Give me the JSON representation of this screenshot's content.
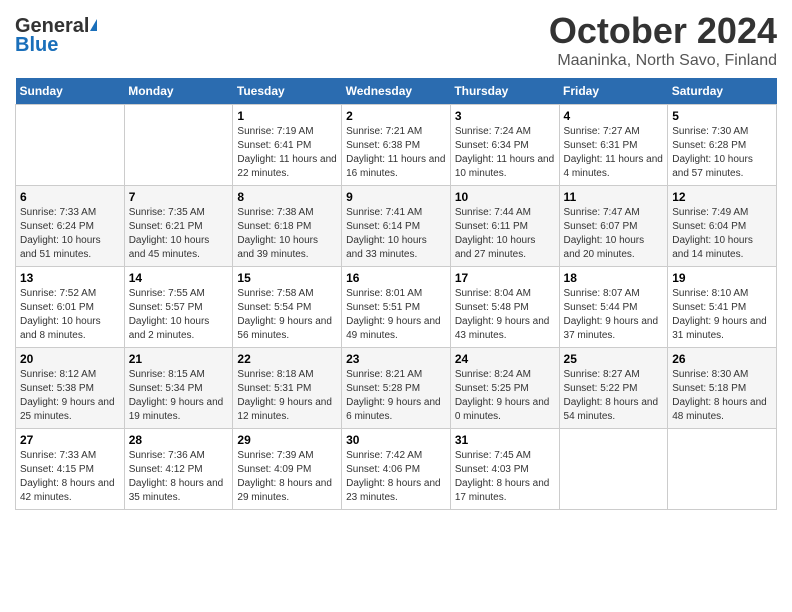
{
  "logo": {
    "general": "General",
    "blue": "Blue"
  },
  "title": {
    "month": "October 2024",
    "location": "Maaninka, North Savo, Finland"
  },
  "days_of_week": [
    "Sunday",
    "Monday",
    "Tuesday",
    "Wednesday",
    "Thursday",
    "Friday",
    "Saturday"
  ],
  "weeks": [
    [
      {
        "day": "",
        "sunrise": "",
        "sunset": "",
        "daylight": ""
      },
      {
        "day": "",
        "sunrise": "",
        "sunset": "",
        "daylight": ""
      },
      {
        "day": "1",
        "sunrise": "Sunrise: 7:19 AM",
        "sunset": "Sunset: 6:41 PM",
        "daylight": "Daylight: 11 hours and 22 minutes."
      },
      {
        "day": "2",
        "sunrise": "Sunrise: 7:21 AM",
        "sunset": "Sunset: 6:38 PM",
        "daylight": "Daylight: 11 hours and 16 minutes."
      },
      {
        "day": "3",
        "sunrise": "Sunrise: 7:24 AM",
        "sunset": "Sunset: 6:34 PM",
        "daylight": "Daylight: 11 hours and 10 minutes."
      },
      {
        "day": "4",
        "sunrise": "Sunrise: 7:27 AM",
        "sunset": "Sunset: 6:31 PM",
        "daylight": "Daylight: 11 hours and 4 minutes."
      },
      {
        "day": "5",
        "sunrise": "Sunrise: 7:30 AM",
        "sunset": "Sunset: 6:28 PM",
        "daylight": "Daylight: 10 hours and 57 minutes."
      }
    ],
    [
      {
        "day": "6",
        "sunrise": "Sunrise: 7:33 AM",
        "sunset": "Sunset: 6:24 PM",
        "daylight": "Daylight: 10 hours and 51 minutes."
      },
      {
        "day": "7",
        "sunrise": "Sunrise: 7:35 AM",
        "sunset": "Sunset: 6:21 PM",
        "daylight": "Daylight: 10 hours and 45 minutes."
      },
      {
        "day": "8",
        "sunrise": "Sunrise: 7:38 AM",
        "sunset": "Sunset: 6:18 PM",
        "daylight": "Daylight: 10 hours and 39 minutes."
      },
      {
        "day": "9",
        "sunrise": "Sunrise: 7:41 AM",
        "sunset": "Sunset: 6:14 PM",
        "daylight": "Daylight: 10 hours and 33 minutes."
      },
      {
        "day": "10",
        "sunrise": "Sunrise: 7:44 AM",
        "sunset": "Sunset: 6:11 PM",
        "daylight": "Daylight: 10 hours and 27 minutes."
      },
      {
        "day": "11",
        "sunrise": "Sunrise: 7:47 AM",
        "sunset": "Sunset: 6:07 PM",
        "daylight": "Daylight: 10 hours and 20 minutes."
      },
      {
        "day": "12",
        "sunrise": "Sunrise: 7:49 AM",
        "sunset": "Sunset: 6:04 PM",
        "daylight": "Daylight: 10 hours and 14 minutes."
      }
    ],
    [
      {
        "day": "13",
        "sunrise": "Sunrise: 7:52 AM",
        "sunset": "Sunset: 6:01 PM",
        "daylight": "Daylight: 10 hours and 8 minutes."
      },
      {
        "day": "14",
        "sunrise": "Sunrise: 7:55 AM",
        "sunset": "Sunset: 5:57 PM",
        "daylight": "Daylight: 10 hours and 2 minutes."
      },
      {
        "day": "15",
        "sunrise": "Sunrise: 7:58 AM",
        "sunset": "Sunset: 5:54 PM",
        "daylight": "Daylight: 9 hours and 56 minutes."
      },
      {
        "day": "16",
        "sunrise": "Sunrise: 8:01 AM",
        "sunset": "Sunset: 5:51 PM",
        "daylight": "Daylight: 9 hours and 49 minutes."
      },
      {
        "day": "17",
        "sunrise": "Sunrise: 8:04 AM",
        "sunset": "Sunset: 5:48 PM",
        "daylight": "Daylight: 9 hours and 43 minutes."
      },
      {
        "day": "18",
        "sunrise": "Sunrise: 8:07 AM",
        "sunset": "Sunset: 5:44 PM",
        "daylight": "Daylight: 9 hours and 37 minutes."
      },
      {
        "day": "19",
        "sunrise": "Sunrise: 8:10 AM",
        "sunset": "Sunset: 5:41 PM",
        "daylight": "Daylight: 9 hours and 31 minutes."
      }
    ],
    [
      {
        "day": "20",
        "sunrise": "Sunrise: 8:12 AM",
        "sunset": "Sunset: 5:38 PM",
        "daylight": "Daylight: 9 hours and 25 minutes."
      },
      {
        "day": "21",
        "sunrise": "Sunrise: 8:15 AM",
        "sunset": "Sunset: 5:34 PM",
        "daylight": "Daylight: 9 hours and 19 minutes."
      },
      {
        "day": "22",
        "sunrise": "Sunrise: 8:18 AM",
        "sunset": "Sunset: 5:31 PM",
        "daylight": "Daylight: 9 hours and 12 minutes."
      },
      {
        "day": "23",
        "sunrise": "Sunrise: 8:21 AM",
        "sunset": "Sunset: 5:28 PM",
        "daylight": "Daylight: 9 hours and 6 minutes."
      },
      {
        "day": "24",
        "sunrise": "Sunrise: 8:24 AM",
        "sunset": "Sunset: 5:25 PM",
        "daylight": "Daylight: 9 hours and 0 minutes."
      },
      {
        "day": "25",
        "sunrise": "Sunrise: 8:27 AM",
        "sunset": "Sunset: 5:22 PM",
        "daylight": "Daylight: 8 hours and 54 minutes."
      },
      {
        "day": "26",
        "sunrise": "Sunrise: 8:30 AM",
        "sunset": "Sunset: 5:18 PM",
        "daylight": "Daylight: 8 hours and 48 minutes."
      }
    ],
    [
      {
        "day": "27",
        "sunrise": "Sunrise: 7:33 AM",
        "sunset": "Sunset: 4:15 PM",
        "daylight": "Daylight: 8 hours and 42 minutes."
      },
      {
        "day": "28",
        "sunrise": "Sunrise: 7:36 AM",
        "sunset": "Sunset: 4:12 PM",
        "daylight": "Daylight: 8 hours and 35 minutes."
      },
      {
        "day": "29",
        "sunrise": "Sunrise: 7:39 AM",
        "sunset": "Sunset: 4:09 PM",
        "daylight": "Daylight: 8 hours and 29 minutes."
      },
      {
        "day": "30",
        "sunrise": "Sunrise: 7:42 AM",
        "sunset": "Sunset: 4:06 PM",
        "daylight": "Daylight: 8 hours and 23 minutes."
      },
      {
        "day": "31",
        "sunrise": "Sunrise: 7:45 AM",
        "sunset": "Sunset: 4:03 PM",
        "daylight": "Daylight: 8 hours and 17 minutes."
      },
      {
        "day": "",
        "sunrise": "",
        "sunset": "",
        "daylight": ""
      },
      {
        "day": "",
        "sunrise": "",
        "sunset": "",
        "daylight": ""
      }
    ]
  ]
}
